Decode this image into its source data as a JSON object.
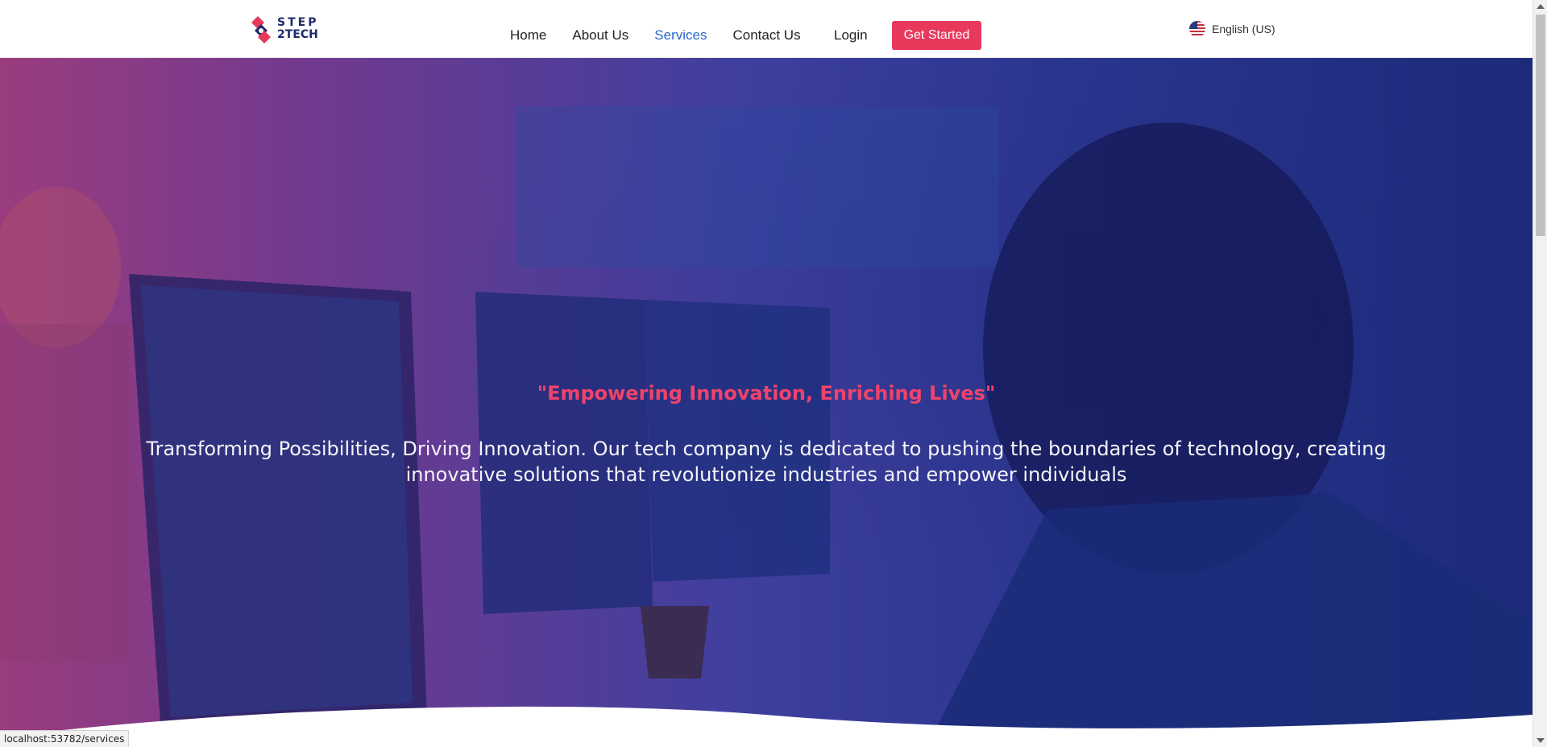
{
  "header": {
    "logo_line1": "STEP",
    "logo_line2": "2TECH",
    "nav": [
      {
        "label": "Home"
      },
      {
        "label": "About Us"
      },
      {
        "label": "Services"
      },
      {
        "label": "Contact Us"
      }
    ],
    "login_label": "Login",
    "cta_label": "Get Started",
    "language_label": "English (US)"
  },
  "hero": {
    "title": "\"Empowering Innovation, Enriching Lives\"",
    "description": "Transforming Possibilities, Driving Innovation. Our tech company is dedicated to pushing the boundaries of technology, creating innovative solutions that revolutionize industries and empower individuals"
  },
  "status_bar": {
    "url": "localhost:53782/services"
  },
  "colors": {
    "accent": "#e8395c",
    "nav_active": "#2a67c9",
    "brand_navy": "#1e2a6b"
  },
  "icons": {
    "logo": "step2tech-logo-icon",
    "flag": "us-flag-icon"
  }
}
